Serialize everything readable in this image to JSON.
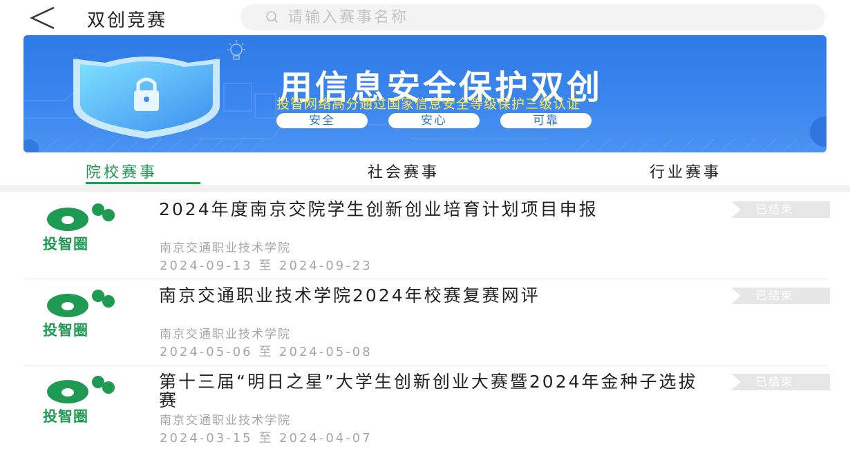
{
  "header": {
    "title": "双创竞赛",
    "search_placeholder": "请输入赛事名称",
    "back_icon": "chevron-left-icon",
    "search_icon": "search-icon"
  },
  "banner": {
    "headline": "用信息安全保护双创",
    "subline": "投智网络高分通过国家信息安全等级保护三级认证",
    "pills": [
      "安全",
      "安心",
      "可靠"
    ],
    "icons": [
      "shield-lock-icon",
      "bulb-icon"
    ],
    "colors": {
      "background": "#3a85ee",
      "subline": "#ffe94a"
    }
  },
  "tabs": [
    {
      "label": "院校赛事",
      "active": true
    },
    {
      "label": "社会赛事",
      "active": false
    },
    {
      "label": "行业赛事",
      "active": false
    }
  ],
  "list": [
    {
      "title": "2024年度南京交院学生创新创业培育计划项目申报",
      "organizer": "南京交通职业技术学院",
      "date_range": "2024-09-13 至 2024-09-23",
      "status": "已结束",
      "logo_text": "投智圈"
    },
    {
      "title": "南京交通职业技术学院2024年校赛复赛网评",
      "organizer": "南京交通职业技术学院",
      "date_range": "2024-05-06 至 2024-05-08",
      "status": "已结束",
      "logo_text": "投智圈"
    },
    {
      "title": "第十三届“明日之星”大学生创新创业大赛暨2024年金种子选拔赛",
      "organizer": "南京交通职业技术学院",
      "date_range": "2024-03-15 至 2024-04-07",
      "status": "已结束",
      "logo_text": "投智圈"
    }
  ],
  "colors": {
    "accent_green": "#1f9a52",
    "status_bg": "#e6e6e6",
    "muted_text": "#a6a6a6"
  }
}
